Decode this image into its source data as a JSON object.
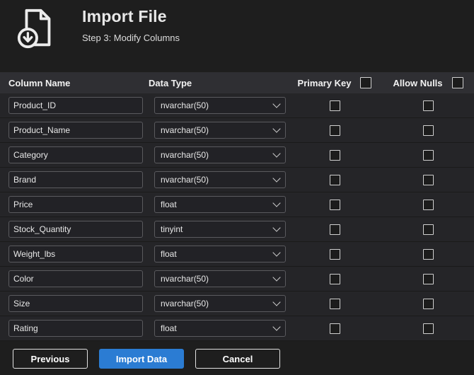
{
  "header": {
    "title": "Import File",
    "subtitle": "Step 3: Modify Columns"
  },
  "table": {
    "headers": {
      "column_name": "Column Name",
      "data_type": "Data Type",
      "primary_key": "Primary Key",
      "allow_nulls": "Allow Nulls"
    },
    "rows": [
      {
        "name": "Product_ID",
        "type": "nvarchar(50)"
      },
      {
        "name": "Product_Name",
        "type": "nvarchar(50)"
      },
      {
        "name": "Category",
        "type": "nvarchar(50)"
      },
      {
        "name": "Brand",
        "type": "nvarchar(50)"
      },
      {
        "name": "Price",
        "type": "float"
      },
      {
        "name": "Stock_Quantity",
        "type": "tinyint"
      },
      {
        "name": "Weight_lbs",
        "type": "float"
      },
      {
        "name": "Color",
        "type": "nvarchar(50)"
      },
      {
        "name": "Size",
        "type": "nvarchar(50)"
      },
      {
        "name": "Rating",
        "type": "float"
      }
    ]
  },
  "buttons": {
    "previous": "Previous",
    "import": "Import Data",
    "cancel": "Cancel"
  },
  "colors": {
    "accent": "#2b7cd3"
  }
}
